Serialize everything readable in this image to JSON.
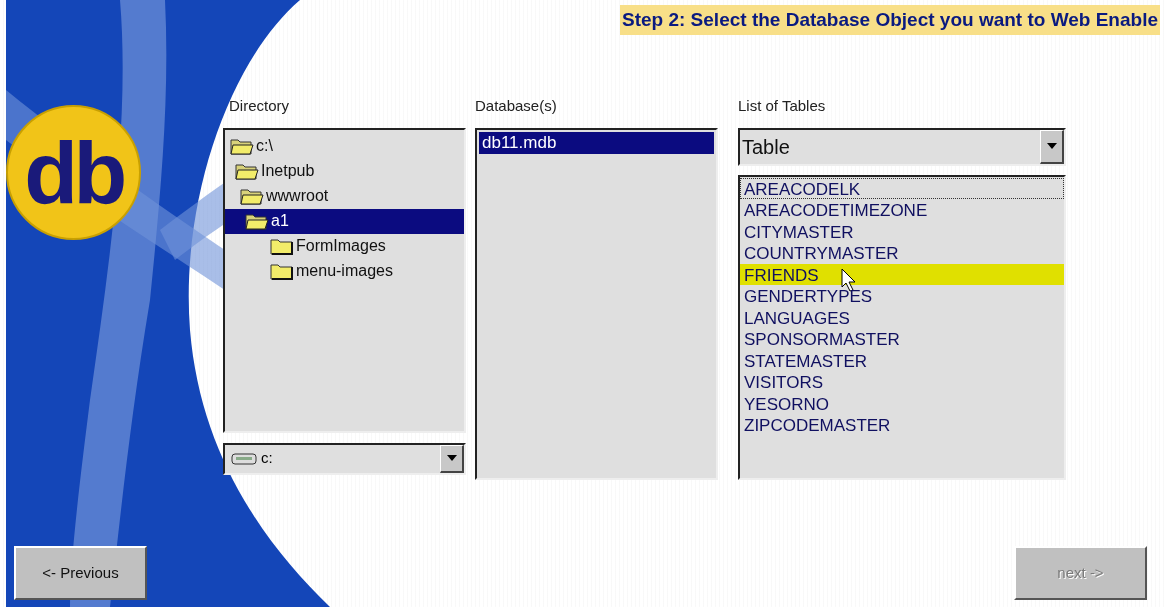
{
  "logo": {
    "text": "db"
  },
  "title": "Step 2: Select the Database Object you want to Web Enable",
  "directory": {
    "label": "Directory",
    "tree": [
      {
        "name": "c:\\",
        "expanded": true,
        "selected": false,
        "children": [
          {
            "name": "Inetpub",
            "expanded": true,
            "selected": false,
            "children": [
              {
                "name": "wwwroot",
                "expanded": true,
                "selected": false,
                "children": [
                  {
                    "name": "a1",
                    "expanded": true,
                    "selected": true,
                    "children": [
                      {
                        "name": "FormImages",
                        "expanded": false,
                        "selected": false
                      },
                      {
                        "name": "menu-images",
                        "expanded": false,
                        "selected": false
                      }
                    ]
                  }
                ]
              }
            ]
          }
        ]
      }
    ],
    "drive": {
      "value": "c:"
    }
  },
  "databases": {
    "label": "Database(s)",
    "items": [
      {
        "name": "db11.mdb",
        "selected": true
      }
    ]
  },
  "tables": {
    "label": "List of Tables",
    "type_select": {
      "value": "Table"
    },
    "items": [
      {
        "name": "AREACODELK",
        "highlighted": false,
        "focused": true
      },
      {
        "name": "AREACODETIMEZONE",
        "highlighted": false,
        "focused": false
      },
      {
        "name": "CITYMASTER",
        "highlighted": false,
        "focused": false
      },
      {
        "name": "COUNTRYMASTER",
        "highlighted": false,
        "focused": false
      },
      {
        "name": "FRIENDS",
        "highlighted": true,
        "focused": false
      },
      {
        "name": "GENDERTYPES",
        "highlighted": false,
        "focused": false
      },
      {
        "name": "LANGUAGES",
        "highlighted": false,
        "focused": false
      },
      {
        "name": "SPONSORMASTER",
        "highlighted": false,
        "focused": false
      },
      {
        "name": "STATEMASTER",
        "highlighted": false,
        "focused": false
      },
      {
        "name": "VISITORS",
        "highlighted": false,
        "focused": false
      },
      {
        "name": "YESORNO",
        "highlighted": false,
        "focused": false
      },
      {
        "name": "ZIPCODEMASTER",
        "highlighted": false,
        "focused": false
      }
    ]
  },
  "buttons": {
    "previous": {
      "label": "<- Previous",
      "disabled": false
    },
    "next": {
      "label": "next ->",
      "disabled": true
    }
  }
}
